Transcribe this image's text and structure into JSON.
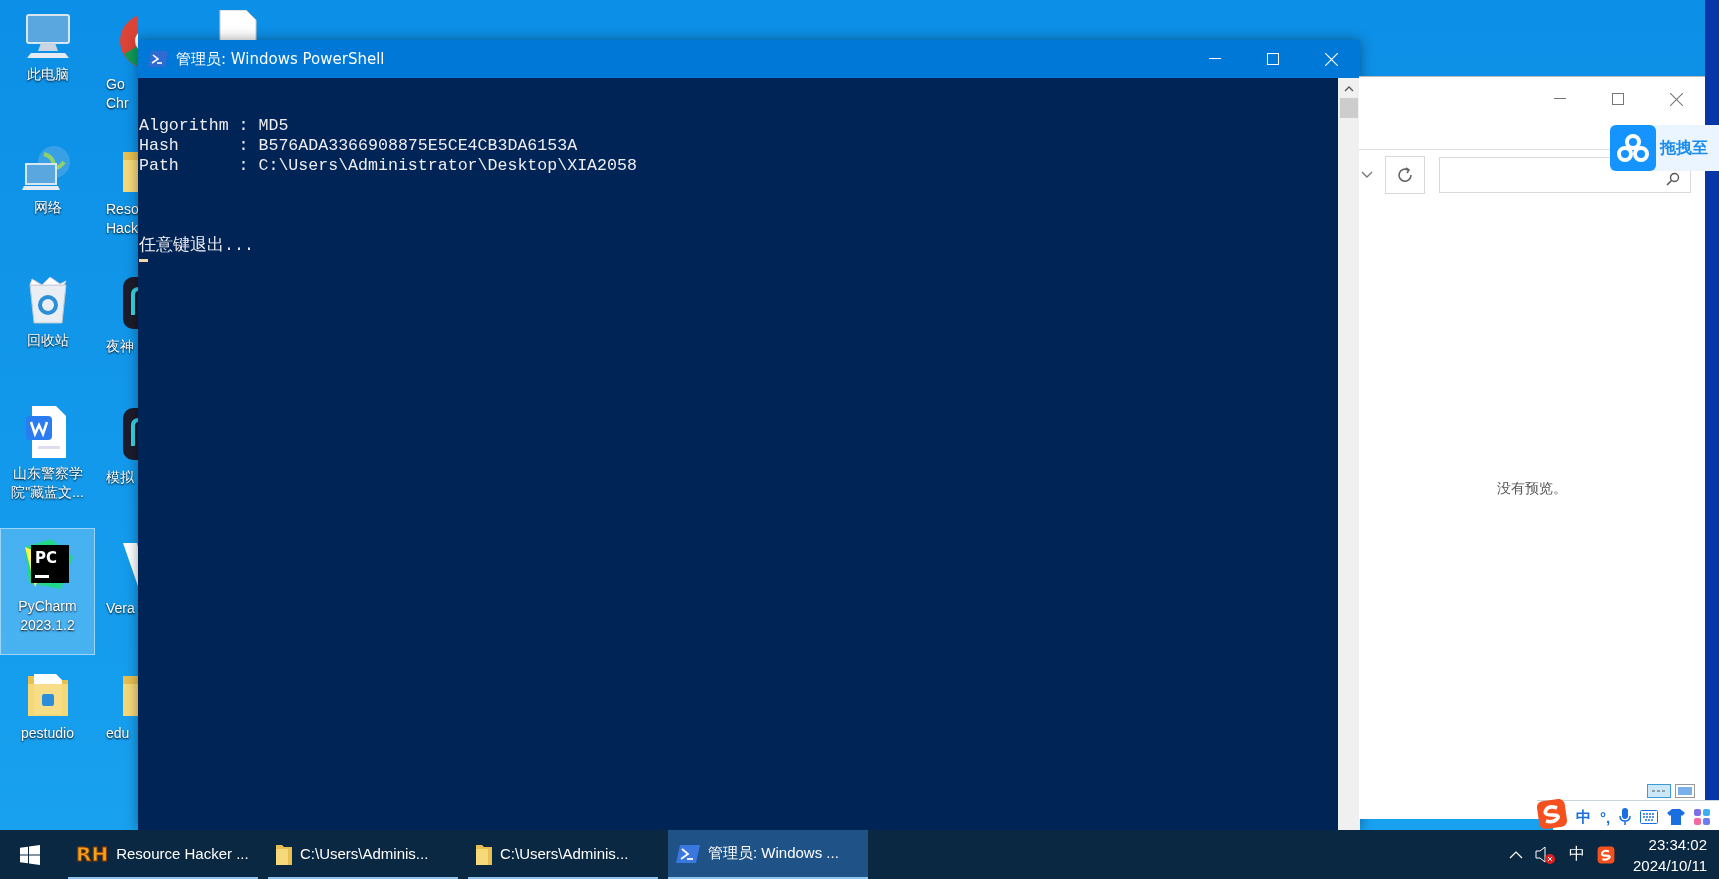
{
  "desktop": {
    "icons": [
      {
        "kind": "computer",
        "label": "此电脑",
        "selected": false
      },
      {
        "kind": "globe",
        "label": "网络",
        "selected": false
      },
      {
        "kind": "recycle",
        "label": "回收站",
        "selected": false
      },
      {
        "kind": "document",
        "label": "山东警察学院\"藏蓝文...",
        "selected": false
      },
      {
        "kind": "pycharm",
        "label": "PyCharm 2023.1.2",
        "logo_text": "PC",
        "selected": true
      },
      {
        "kind": "folder",
        "label": "pestudio",
        "selected": false
      }
    ],
    "covered_icons": [
      {
        "kind": "chrome",
        "label_lines": [
          "Go",
          "Chr"
        ],
        "selected": false
      },
      {
        "kind": "folder",
        "label_lines": [
          "Reso",
          "Hack"
        ],
        "selected": false
      },
      {
        "kind": "emulator",
        "label_lines": [
          "夜神"
        ],
        "selected": false
      },
      {
        "kind": "emulator",
        "label_lines": [
          "模拟"
        ],
        "selected": false
      },
      {
        "kind": "vera",
        "label_lines": [
          "Vera"
        ],
        "selected": false
      },
      {
        "kind": "folder",
        "label_lines": [
          "edu"
        ],
        "selected": false
      }
    ]
  },
  "powershell": {
    "title": "管理员: Windows PowerShell",
    "output": [
      "Algorithm : MD5",
      "Hash      : B576ADA3366908875E5CE4CB3DA6153A",
      "Path      : C:\\Users\\Administrator\\Desktop\\XIA2058"
    ],
    "prompt": "任意键退出..."
  },
  "explorer": {
    "preview_text": "没有预览。"
  },
  "cloud_popup": {
    "text": "拖拽至"
  },
  "ime_bar": {
    "mode": "中",
    "punctuation": "°,"
  },
  "taskbar": {
    "items": [
      {
        "kind": "app",
        "logo_text": "RH",
        "label": "Resource Hacker ...",
        "selected": false
      },
      {
        "kind": "folder",
        "label": "C:\\Users\\Adminis...",
        "selected": false
      },
      {
        "kind": "folder",
        "label": "C:\\Users\\Adminis...",
        "selected": false
      },
      {
        "kind": "powershell",
        "label": "管理员: Windows ...",
        "selected": true
      }
    ],
    "ime": "中",
    "time": "23:34:02",
    "date": "2024/10/11"
  }
}
